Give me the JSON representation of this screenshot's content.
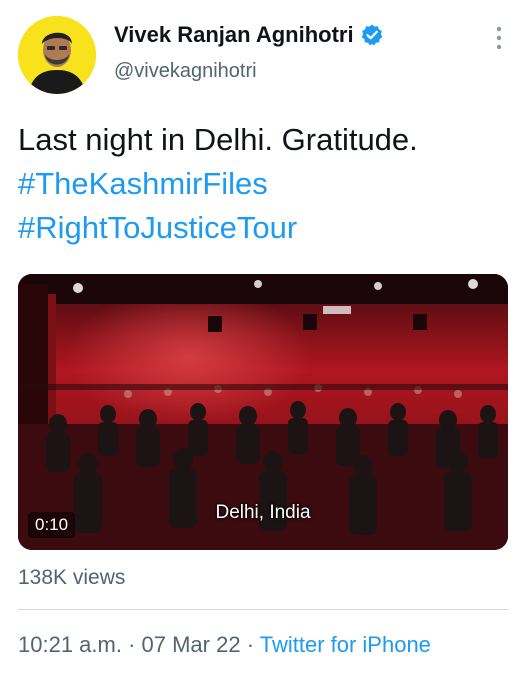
{
  "author": {
    "display_name": "Vivek Ranjan Agnihotri",
    "handle": "@vivekagnihotri",
    "verified": true,
    "avatar_bg": "#f7e21b"
  },
  "tweet": {
    "text_line1": "Last night in Delhi. Gratitude.",
    "hashtag1": "#TheKashmirFiles",
    "hashtag2": "#RightToJusticeTour"
  },
  "media": {
    "duration": "0:10",
    "caption": "Delhi, India"
  },
  "stats": {
    "views": "138K views"
  },
  "meta": {
    "time": "10:21 a.m.",
    "sep1": " · ",
    "date": "07 Mar 22",
    "sep2": " · ",
    "source": "Twitter for iPhone"
  },
  "icons": {
    "verified": "verified-badge-icon",
    "more": "more-options-icon"
  },
  "colors": {
    "link": "#1d9bf0",
    "secondary_text": "#536471",
    "primary_text": "#0f1419"
  }
}
